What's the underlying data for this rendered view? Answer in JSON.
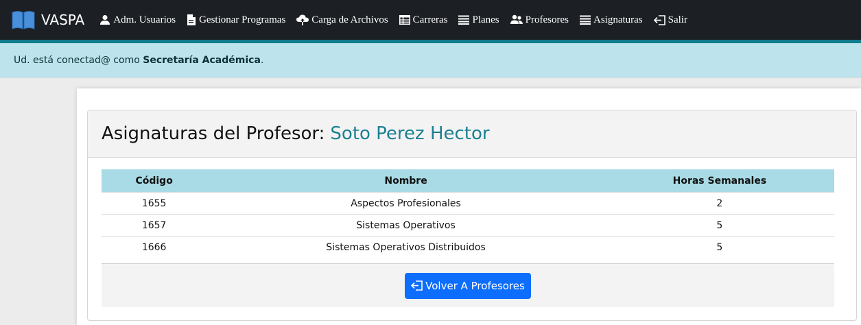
{
  "navbar": {
    "brand": "VASPA",
    "items": [
      {
        "label": "Adm. Usuarios",
        "icon": "user-icon"
      },
      {
        "label": "Gestionar Programas",
        "icon": "file-icon"
      },
      {
        "label": "Carga de Archivos",
        "icon": "cloud-upload-icon"
      },
      {
        "label": "Carreras",
        "icon": "table-icon"
      },
      {
        "label": "Planes",
        "icon": "list-icon"
      },
      {
        "label": "Profesores",
        "icon": "people-icon"
      },
      {
        "label": "Asignaturas",
        "icon": "list-icon"
      },
      {
        "label": "Salir",
        "icon": "logout-icon"
      }
    ]
  },
  "alert": {
    "prefix": "Ud. está conectad@ como ",
    "role": "Secretaría Académica",
    "suffix": "."
  },
  "card": {
    "title": "Asignaturas del Profesor:",
    "professor": "Soto Perez Hector"
  },
  "table": {
    "headers": [
      "Código",
      "Nombre",
      "Horas Semanales"
    ],
    "rows": [
      {
        "codigo": "1655",
        "nombre": "Aspectos Profesionales",
        "horas": "2"
      },
      {
        "codigo": "1657",
        "nombre": "Sistemas Operativos",
        "horas": "5"
      },
      {
        "codigo": "1666",
        "nombre": "Sistemas Operativos Distribuidos",
        "horas": "5"
      }
    ]
  },
  "button": {
    "label": "Volver A Profesores",
    "icon": "logout-icon"
  },
  "colors": {
    "navbar_bg": "#1c2024",
    "navbar_border": "#127c8c",
    "alert_bg": "#bde4ec",
    "table_header_bg": "#a8dbe5",
    "professor_name": "#1b8091",
    "button_bg": "#0d6efd"
  }
}
